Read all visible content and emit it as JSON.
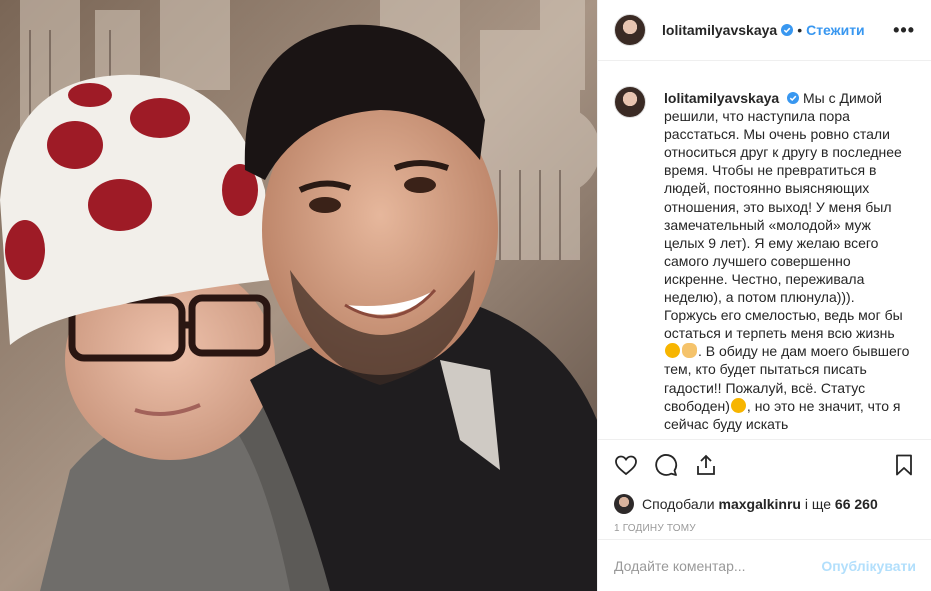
{
  "post": {
    "username": "lolitamilyavskaya",
    "separator": "•",
    "follow_label": "Стежити",
    "more_label": "•••"
  },
  "caption": {
    "username": "lolitamilyavskaya",
    "part1": "Мы с Димой решили, что наступила пора расстаться. Мы очень ровно стали относиться друг к другу в последнее время. Чтобы не превратиться в людей, постоянно выясняющих отношения, это выход! У меня был замечательный «молодой» муж целых 9 лет). Я ему желаю всего самого лучшего совершенно искренне. Честно, переживала неделю), а потом плюнула))). Горжусь его смелостью, ведь мог бы остаться и терпеть меня всю жизнь",
    "part2": ". В обиду не дам моего бывшего тем, кто будет пытаться писать гадости!! Пожалуй, всё. Статус свободен)",
    "part3": ", но это не значит, что я сейчас буду искать"
  },
  "likes": {
    "prefix": "Сподобали",
    "user": "maxgalkinru",
    "suffix": "і ще",
    "count": "66 260"
  },
  "timestamp": "1 годину тому",
  "comment": {
    "placeholder": "Додайте коментар...",
    "publish_label": "Опублікувати"
  },
  "icons": [
    "heart-icon",
    "comment-icon",
    "share-icon",
    "bookmark-icon",
    "verified-badge-icon"
  ],
  "colors": {
    "link": "#3897f0",
    "verified": "#3897f0",
    "publish_disabled": "#b2dffc",
    "meta": "#999999"
  }
}
